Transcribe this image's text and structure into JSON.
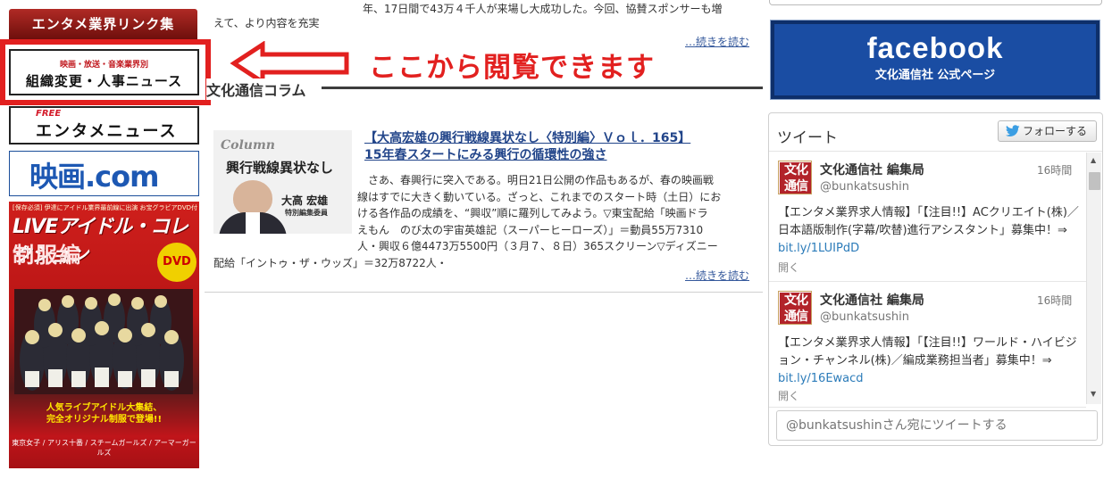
{
  "sidebar": {
    "header": "エンタメ業界リンク集",
    "banner_personnel": {
      "small": "映画・放送・音楽業界別",
      "big": "組織変更・人事ニュース"
    },
    "banner_news": {
      "free": "FREE",
      "big": "エンタメニュース"
    },
    "banner_eiga": {
      "text": "映画.com"
    },
    "book": {
      "top": "[保存必須] 伊達にアイドル業界最前線に出演 お宝グラビアDVD付",
      "title": "LIVEアイドル・コレクション",
      "subtitle": "制服編",
      "dvd": "DVD",
      "tagline1": "人気ライブアイドル大集結、",
      "tagline2": "完全オリジナル制服で登場!!",
      "names": "東京女子 / アリス十番 / スチームガールズ / アーマーガールズ"
    }
  },
  "annotation": {
    "callout": "ここから閲覧できます",
    "arrow_color": "#e2201f"
  },
  "center": {
    "prev_snippet_left": "えて、より内容を充実",
    "prev_snippet_right": "年、17日間で43万４千人が来場し大成功した。今回、協賛スポンサーも増",
    "read_more_1": "…続きを読む",
    "section_title": "文化通信コラム",
    "column_image": {
      "label": "Column",
      "heading": "興行戦線異状なし",
      "author": "大高 宏雄",
      "role": "特別編集委員"
    },
    "article_title_1": "【大高宏雄の興行戦線異状なし〈特別編〉Ｖｏｌ．165】",
    "article_title_2": "15年春スタートにみる興行の循環性の強さ",
    "article_body": [
      "　さあ、春興行に突入である。明日21日公開の作品もあるが、春の映画戦",
      "線はすでに大きく動いている。ざっと、これまでのスタート時（土日）にお",
      "ける各作品の成績を、“興収”順に羅列してみよう。▽東宝配給「映画ドラ",
      "えもん　のび太の宇宙英雄記（スーパーヒーローズ）」＝動員55万7310",
      "人・興収６億4473万5500円（３月７、８日）365スクリーン▽ディズニー",
      "配給「イントゥ・ザ・ウッズ」＝32万8722人・"
    ],
    "read_more_2": "…続きを読む"
  },
  "right": {
    "facebook": {
      "title": "facebook",
      "subtitle": "文化通信社 公式ページ"
    },
    "twitter": {
      "header": "ツイート",
      "follow_label": "フォローする",
      "compose_placeholder": "@bunkatsushinさん宛にツイートする",
      "tweets": [
        {
          "avatar_top": "文化",
          "avatar_bottom": "通信",
          "name": "文化通信社 編集局",
          "handle": "@bunkatsushin",
          "time": "16時間",
          "text": "【エンタメ業界求人情報】「【注目!!】ACクリエイト(株)／日本語版制作(字幕/吹替)進行アシスタント」募集中！⇒ ",
          "link": "bit.ly/1LUIPdD",
          "expand": "開く"
        },
        {
          "avatar_top": "文化",
          "avatar_bottom": "通信",
          "name": "文化通信社 編集局",
          "handle": "@bunkatsushin",
          "time": "16時間",
          "text": "【エンタメ業界求人情報】「【注目!!】ワールド・ハイビジョン・チャンネル(株)／編成業務担当者」募集中！⇒ ",
          "link": "bit.ly/16Ewacd",
          "expand": "開く"
        }
      ]
    }
  },
  "colors": {
    "accent_red": "#e2201f",
    "facebook_blue": "#1a4da3",
    "link_blue": "#22458a",
    "twitter_link": "#2b7bb9"
  }
}
